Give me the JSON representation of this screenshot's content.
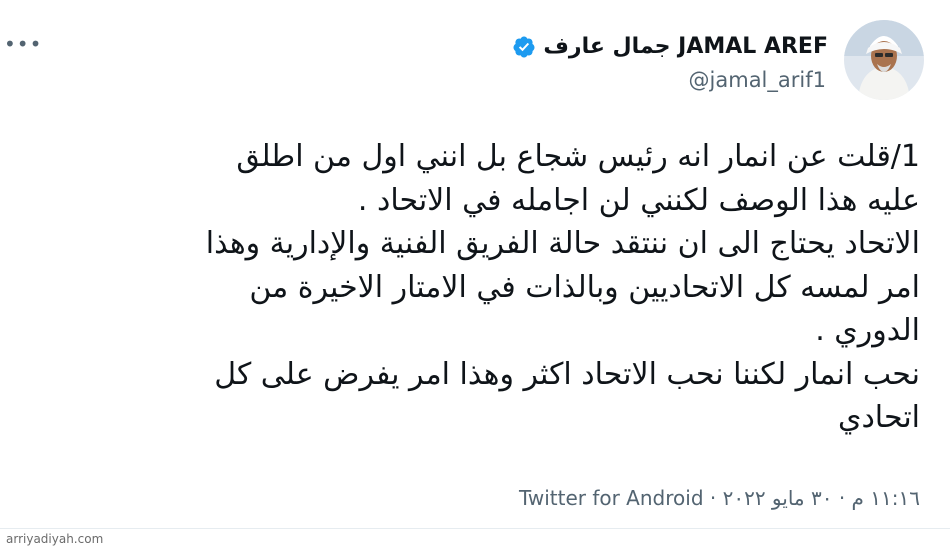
{
  "tweet": {
    "more_icon": "more-horizontal-icon",
    "author": {
      "display_name": "جمال عارف JAMAL AREF",
      "handle": "@jamal_arif1",
      "verified_icon": "verified-badge-icon",
      "verified_color": "#1d9bf0",
      "avatar_icon": "profile-avatar"
    },
    "text_lines": [
      "1/قلت عن انمار انه رئيس شجاع بل انني اول من اطلق",
      "عليه هذا الوصف لكنني لن اجامله في الاتحاد .",
      "الاتحاد يحتاج الى ان ننتقد حالة الفريق الفنية والإدارية وهذا",
      "امر لمسه كل الاتحاديين وبالذات في الامتار الاخيرة من",
      "الدوري .",
      "نحب انمار لكننا نحب الاتحاد اكثر وهذا امر  يفرض على كل",
      "اتحادي"
    ],
    "meta": "١١:١٦ م · ٣٠ مايو ٢٠٢٢ · Twitter for Android"
  },
  "watermark": "arriyadiyah.com"
}
